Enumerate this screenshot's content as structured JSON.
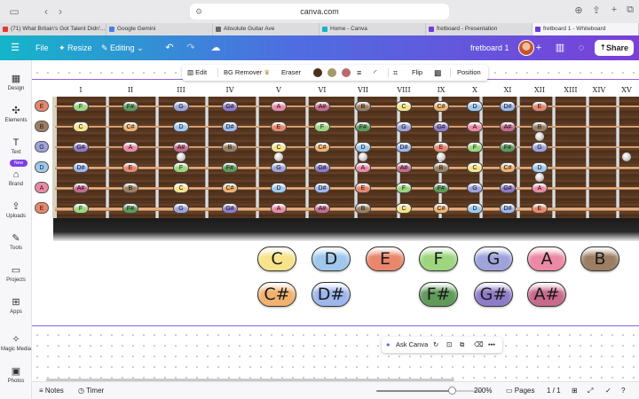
{
  "browser": {
    "url": "canva.com",
    "tabs": [
      {
        "title": "(71) What Britain's Got Talent Didn'...",
        "color": "#e53935"
      },
      {
        "title": "Google Gemini",
        "color": "#4a7fe0"
      },
      {
        "title": "Absolute Guitar Ave",
        "color": "#666666"
      },
      {
        "title": "Home - Canva",
        "color": "#16b2c8"
      },
      {
        "title": "fretboard - Presentation",
        "color": "#6a3fd8"
      },
      {
        "title": "fretboard 1 - Whiteboard",
        "color": "#6a3fd8"
      }
    ]
  },
  "canva": {
    "file": "File",
    "resize": "Resize",
    "editing": "Editing",
    "doc_title": "fretboard 1",
    "share": "Share"
  },
  "sidebar": [
    {
      "label": "Design",
      "icon": "design-icon"
    },
    {
      "label": "Elements",
      "icon": "elements-icon"
    },
    {
      "label": "Text",
      "icon": "text-icon"
    },
    {
      "label": "Brand",
      "icon": "brand-icon"
    },
    {
      "label": "Uploads",
      "icon": "uploads-icon"
    },
    {
      "label": "Tools",
      "icon": "tools-icon"
    },
    {
      "label": "Projects",
      "icon": "projects-icon"
    },
    {
      "label": "Apps",
      "icon": "apps-icon"
    },
    {
      "label": "Magic Media",
      "icon": "magic-media-icon"
    },
    {
      "label": "Photos",
      "icon": "photos-icon"
    }
  ],
  "new_badge": "New",
  "image_toolbar": {
    "edit": "Edit",
    "bg_remover": "BG Remover",
    "eraser": "Eraser",
    "flip": "Flip",
    "position": "Position",
    "colors": [
      "#4a2f1c",
      "#a39a6a",
      "#b86c70"
    ]
  },
  "note_colors": {
    "C": "#f6e38a",
    "C#": "#f0b26e",
    "D": "#9fc8ec",
    "D#": "#9db6ec",
    "E": "#e8876b",
    "F": "#9ed67f",
    "F#": "#5f9a5a",
    "G": "#9ea3dc",
    "G#": "#8f7cc8",
    "A": "#ec8aa6",
    "A#": "#c86a8c",
    "B": "#9c7f62"
  },
  "fretboard": {
    "fret_numbers": [
      "I",
      "II",
      "III",
      "IV",
      "V",
      "VI",
      "VII",
      "VIII",
      "IX",
      "X",
      "XI",
      "XII",
      "XIII",
      "XIV",
      "XV"
    ],
    "strings": [
      {
        "open": "E",
        "notes": [
          "F",
          "F#",
          "G",
          "G#",
          "A",
          "A#",
          "B",
          "C",
          "C#",
          "D",
          "D#",
          "E"
        ]
      },
      {
        "open": "B",
        "notes": [
          "C",
          "C#",
          "D",
          "D#",
          "E",
          "F",
          "F#",
          "G",
          "G#",
          "A",
          "A#",
          "B"
        ]
      },
      {
        "open": "G",
        "notes": [
          "G#",
          "A",
          "A#",
          "B",
          "C",
          "C#",
          "D",
          "D#",
          "E",
          "F",
          "F#",
          "G"
        ]
      },
      {
        "open": "D",
        "notes": [
          "D#",
          "E",
          "F",
          "F#",
          "G",
          "G#",
          "A",
          "A#",
          "B",
          "C",
          "C#",
          "D"
        ]
      },
      {
        "open": "A",
        "notes": [
          "A#",
          "B",
          "C",
          "C#",
          "D",
          "D#",
          "E",
          "F",
          "F#",
          "G",
          "G#",
          "A"
        ]
      },
      {
        "open": "E",
        "notes": [
          "F",
          "F#",
          "G",
          "G#",
          "A",
          "A#",
          "B",
          "C",
          "C#",
          "D",
          "D#",
          "E"
        ]
      }
    ]
  },
  "legend": {
    "naturals": [
      "C",
      "D",
      "E",
      "F",
      "G",
      "A",
      "B"
    ],
    "sharps": [
      "C#",
      "D#",
      "F#",
      "G#",
      "A#"
    ]
  },
  "ask_canva": "Ask Canva",
  "status": {
    "notes": "Notes",
    "timer": "Timer",
    "zoom": "200%",
    "zoom_level_fraction": 0.72,
    "pages": "Pages",
    "page_count": "1 / 1"
  }
}
